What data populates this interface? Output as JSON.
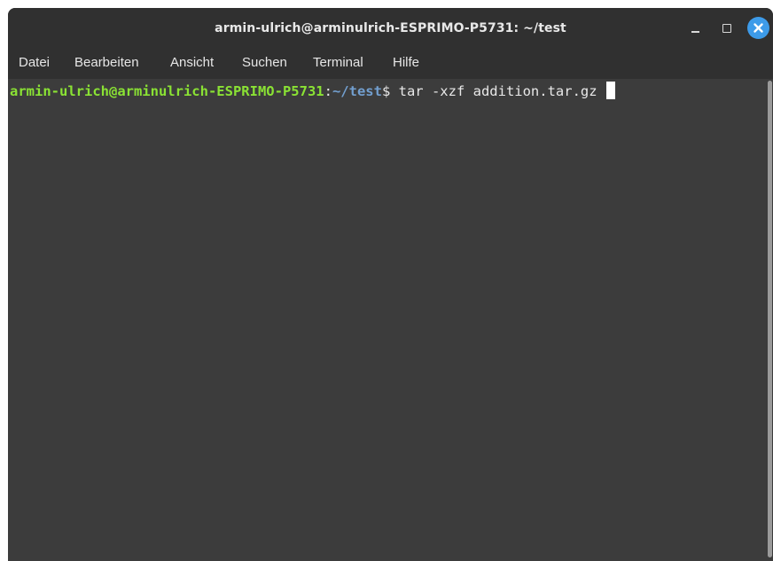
{
  "window": {
    "title": "armin-ulrich@arminulrich-ESPRIMO-P5731: ~/test"
  },
  "menu": {
    "items": [
      "Datei",
      "Bearbeiten",
      "Ansicht",
      "Suchen",
      "Terminal",
      "Hilfe"
    ]
  },
  "terminal": {
    "prompt_user_host": "armin-ulrich@arminulrich-ESPRIMO-P5731",
    "prompt_colon": ":",
    "prompt_path": "~/test",
    "prompt_symbol": "$ ",
    "command": "tar -xzf addition.tar.gz "
  },
  "colors": {
    "user_host": "#8ae234",
    "path": "#729fcf",
    "close_button": "#3d9be9",
    "background": "#3c3c3c"
  },
  "icons": [
    "minimize-icon",
    "maximize-icon",
    "close-icon"
  ]
}
